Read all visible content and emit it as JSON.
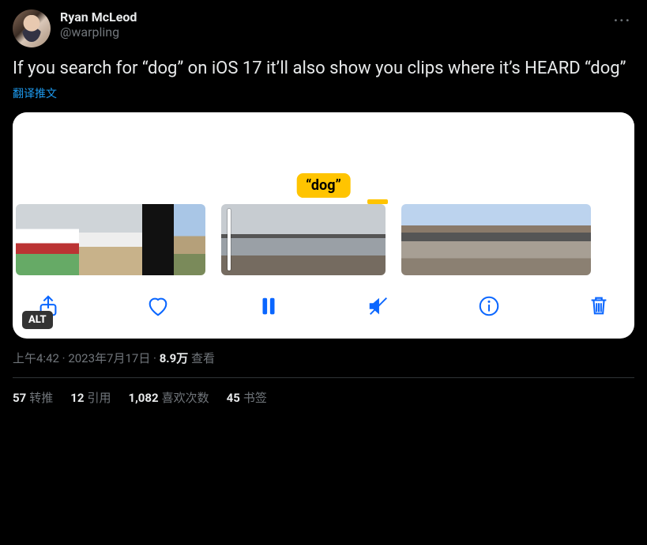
{
  "author": {
    "display_name": "Ryan McLeod",
    "handle": "@warpling"
  },
  "tweet_text": "If you search for “dog” on iOS 17 it’ll also show you clips where it’s HEARD “dog”",
  "translate_label": "翻译推文",
  "media": {
    "search_tag": "“dog”",
    "alt_badge": "ALT"
  },
  "meta": {
    "time": "上午4:42",
    "sep1": " · ",
    "date": "2023年7月17日",
    "sep2": " · ",
    "views_count": "8.9万",
    "views_label": " 查看"
  },
  "stats": {
    "retweets": {
      "count": "57",
      "label": "转推"
    },
    "quotes": {
      "count": "12",
      "label": "引用"
    },
    "likes": {
      "count": "1,082",
      "label": "喜欢次数"
    },
    "bookmarks": {
      "count": "45",
      "label": "书签"
    }
  }
}
